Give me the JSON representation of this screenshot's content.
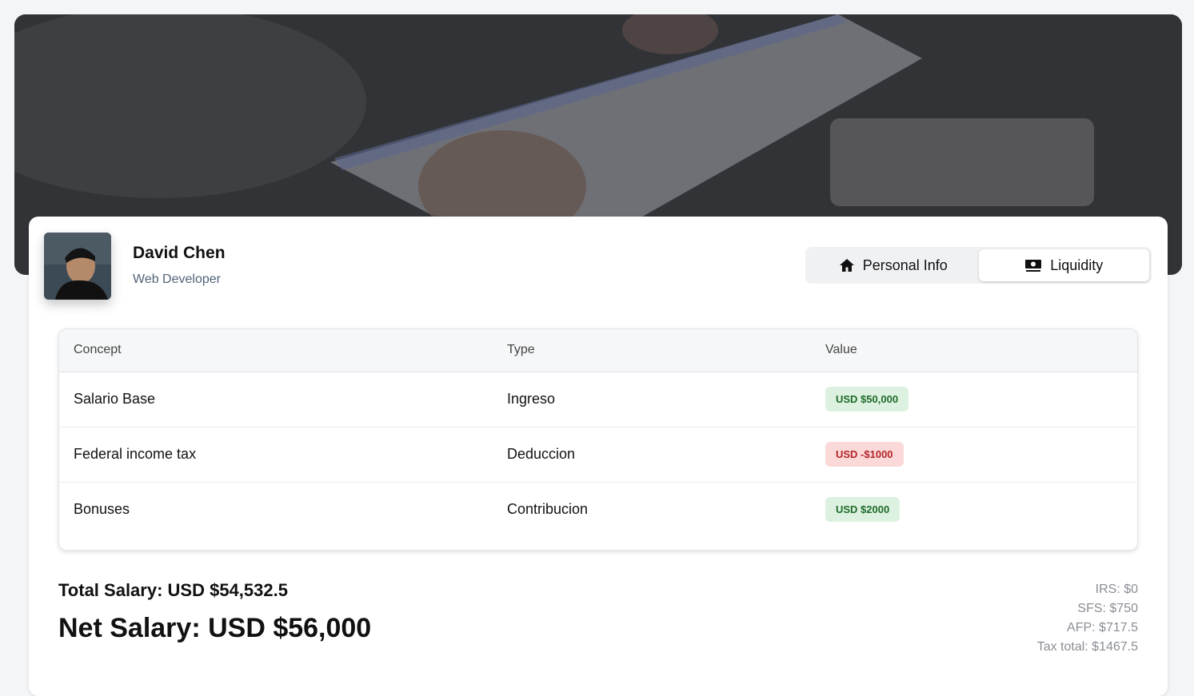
{
  "profile": {
    "name": "David Chen",
    "role": "Web Developer"
  },
  "tabs": [
    {
      "label": "Personal Info",
      "icon": "home-icon",
      "active": false
    },
    {
      "label": "Liquidity",
      "icon": "money-icon",
      "active": true
    }
  ],
  "table": {
    "headers": [
      "Concept",
      "Type",
      "Value"
    ],
    "rows": [
      {
        "concept": "Salario Base",
        "type": "Ingreso",
        "value": "USD $50,000",
        "status": "positive"
      },
      {
        "concept": "Federal income tax",
        "type": "Deduccion",
        "value": "USD -$1000",
        "status": "negative"
      },
      {
        "concept": "Bonuses",
        "type": "Contribucion",
        "value": "USD $2000",
        "status": "positive"
      }
    ]
  },
  "summary": {
    "total_salary": "Total Salary: USD $54,532.5",
    "net_salary": "Net Salary: USD $56,000"
  },
  "taxes": {
    "irs": "IRS: $0",
    "sfs": "SFS: $750",
    "afp": "AFP: $717.5",
    "total": "Tax total: $1467.5"
  },
  "colors": {
    "positive_bg": "#dcf1df",
    "positive_text": "#1f6b2b",
    "negative_bg": "#fbd9d9",
    "negative_text": "#b3262c",
    "subtitle": "#52637a"
  }
}
